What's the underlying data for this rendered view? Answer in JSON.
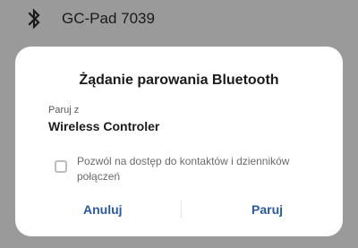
{
  "background_row": {
    "device_name": "GC-Pad 7039",
    "icon": "bluetooth-icon"
  },
  "dialog": {
    "title": "Żądanie parowania Bluetooth",
    "pair_with_label": "Paruj z",
    "device_name": "Wireless Controler",
    "checkbox": {
      "label": "Pozwól na dostęp do kontaktów i dzienników połączeń",
      "checked": false
    },
    "buttons": {
      "cancel": "Anuluj",
      "pair": "Paruj"
    }
  },
  "colors": {
    "backdrop": "#9a9a9a",
    "dialog_bg": "#ffffff",
    "accent": "#2a5aa8",
    "title_text": "#1b1b1b",
    "secondary_text": "#6b6b6b"
  }
}
